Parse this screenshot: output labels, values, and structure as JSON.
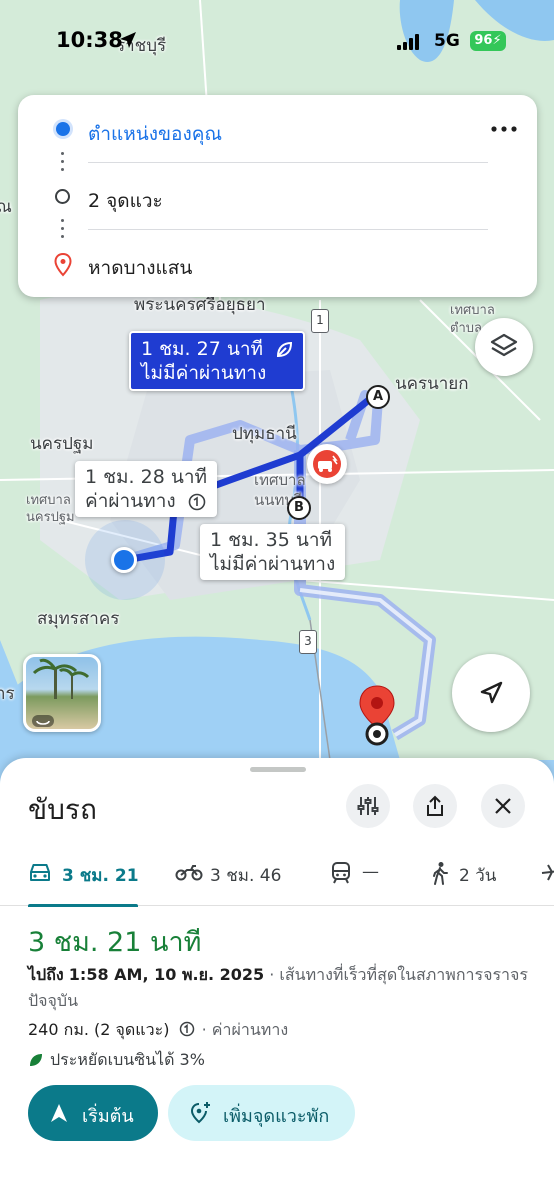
{
  "status": {
    "time": "10:38",
    "network": "5G",
    "battery": "96"
  },
  "map": {
    "labels": {
      "bg_fragment_1": "ราชบุรี",
      "bg_fragment_2": "ณ",
      "ayutthaya": "พระนครศรีอยุธยา",
      "nakhon_nayok": "นครนายก",
      "pathum_thani": "ปทุมธานี",
      "nakhon_pathom": "นครปฐม",
      "nakhon_pathom_muni": "เทศบาลนครปฐม",
      "nonthaburi": "เทศบาลนนทบุรี",
      "samut_sakhon": "สมุทรสาคร",
      "fragment_ra": "าร",
      "top_right_muni": "เทศบาล ตำบล"
    },
    "road_shields": [
      "1",
      "3"
    ],
    "waypoints": [
      "A",
      "B"
    ],
    "callouts": {
      "primary": {
        "time": "1 ชม. 27 นาที",
        "toll": "ไม่มีค่าผ่านทาง"
      },
      "alt1": {
        "time": "1 ชม. 28 นาที",
        "toll": "ค่าผ่านทาง"
      },
      "alt2": {
        "time": "1 ชม. 35 นาที",
        "toll": "ไม่มีค่าผ่านทาง"
      }
    }
  },
  "route_card": {
    "origin": "ตำแหน่งของคุณ",
    "stops": "2 จุดแวะ",
    "destination": "หาดบางแสน"
  },
  "sheet": {
    "title": "ขับรถ",
    "modes": [
      {
        "icon": "car-icon",
        "label": "3 ชม. 21"
      },
      {
        "icon": "motorcycle-icon",
        "label": "3 ชม. 46"
      },
      {
        "icon": "train-icon",
        "label": "—"
      },
      {
        "icon": "walk-icon",
        "label": "2 วัน"
      }
    ],
    "duration": "3 ชม. 21 นาที",
    "arrival_prefix": "ไปถึง",
    "arrival_time": "1:58 AM, 10 พ.ย. 2025",
    "route_note": "· เส้นทางที่เร็วที่สุดในสภาพการจราจรปัจจุบัน",
    "distance": "240 กม. (2 จุดแวะ)",
    "toll_note": "· ค่าผ่านทาง",
    "fuel": "ประหยัดเบนซินได้ 3%",
    "start_label": "เริ่มต้น",
    "add_stop_label": "เพิ่มจุดแวะพัก"
  },
  "colors": {
    "accent": "#0b7a8a",
    "route_blue": "#1f3cd1",
    "green": "#188038",
    "pin_red": "#ea4335"
  }
}
